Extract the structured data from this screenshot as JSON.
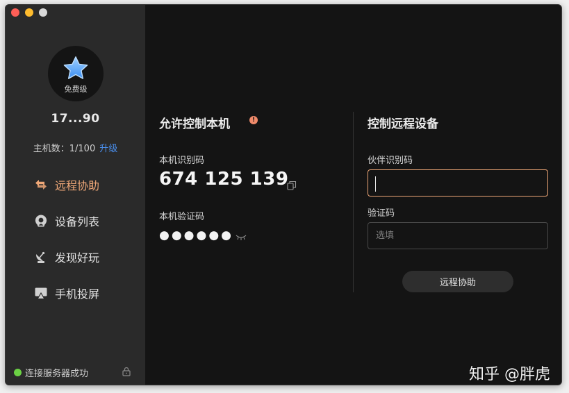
{
  "sidebar": {
    "tier": "免费级",
    "user_id": "17...90",
    "host_count_label": "主机数：1/100",
    "upgrade_label": "升级",
    "nav": [
      {
        "label": "远程协助",
        "icon": "swap-arrows-icon",
        "active": true
      },
      {
        "label": "设备列表",
        "icon": "device-list-icon",
        "active": false
      },
      {
        "label": "发现好玩",
        "icon": "satellite-dish-icon",
        "active": false
      },
      {
        "label": "手机投屏",
        "icon": "screen-cast-icon",
        "active": false
      }
    ],
    "status_text": "连接服务器成功"
  },
  "allow": {
    "title": "允许控制本机",
    "id_label": "本机识别码",
    "id_value": "674 125 139",
    "code_label": "本机验证码",
    "code_value": "●●●●●●"
  },
  "control": {
    "title": "控制远程设备",
    "partner_label": "伙伴识别码",
    "partner_value": "",
    "code_label": "验证码",
    "code_placeholder": "选填",
    "submit_label": "远程协助"
  },
  "watermark": "知乎 @胖虎",
  "colors": {
    "accent": "#f0a878",
    "link": "#4a90f0",
    "status_ok": "#6bd144",
    "warning": "#f08a6a"
  }
}
